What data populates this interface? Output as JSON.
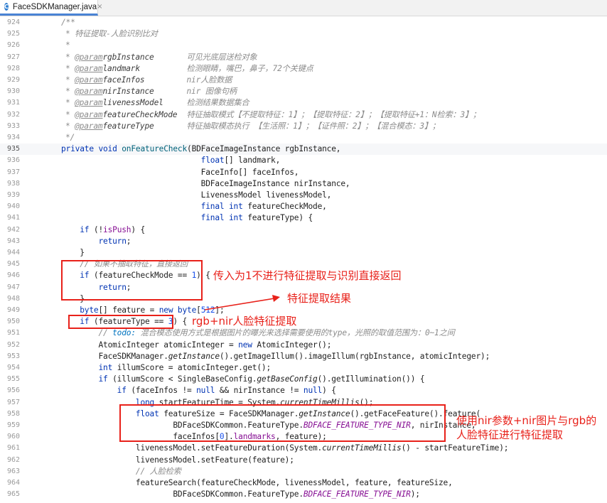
{
  "tab": {
    "icon": "C",
    "label": "FaceSDKManager.java",
    "close": "×"
  },
  "lines": [
    {
      "n": "924",
      "t": [
        [
          "",
          "/**",
          "cm"
        ]
      ]
    },
    {
      "n": "925",
      "t": [
        [
          "",
          "* 特征提取-人脸识别比对",
          "cm"
        ]
      ]
    },
    {
      "n": "926",
      "t": [
        [
          "",
          "*",
          "cm"
        ]
      ]
    },
    {
      "n": "927",
      "t": [
        [
          "",
          "* ",
          "cm"
        ],
        [
          "",
          "@param",
          "tag"
        ],
        [
          "",
          "rgbInstance       ",
          "pn"
        ],
        [
          "",
          "可见光底层送检对象",
          "cm"
        ]
      ]
    },
    {
      "n": "928",
      "t": [
        [
          "",
          "* ",
          "cm"
        ],
        [
          "",
          "@param",
          "tag"
        ],
        [
          "",
          "landmark          ",
          "pn"
        ],
        [
          "",
          "检测眼睛，嘴巴，鼻子，72个关键点",
          "cm"
        ]
      ]
    },
    {
      "n": "929",
      "t": [
        [
          "",
          "* ",
          "cm"
        ],
        [
          "",
          "@param",
          "tag"
        ],
        [
          "",
          "faceInfos         ",
          "pn"
        ],
        [
          "",
          "nir人脸数据",
          "cm"
        ]
      ]
    },
    {
      "n": "930",
      "t": [
        [
          "",
          "* ",
          "cm"
        ],
        [
          "",
          "@param",
          "tag"
        ],
        [
          "",
          "nirInstance       ",
          "pn"
        ],
        [
          "",
          "nir 图像句柄",
          "cm"
        ]
      ]
    },
    {
      "n": "931",
      "t": [
        [
          "",
          "* ",
          "cm"
        ],
        [
          "",
          "@param",
          "tag"
        ],
        [
          "",
          "livenessModel     ",
          "pn"
        ],
        [
          "",
          "检测结果数据集合",
          "cm"
        ]
      ]
    },
    {
      "n": "932",
      "t": [
        [
          "",
          "* ",
          "cm"
        ],
        [
          "",
          "@param",
          "tag"
        ],
        [
          "",
          "featureCheckMode  ",
          "pn"
        ],
        [
          "",
          "特征抽取模式【不提取特征：1】；【提取特征：2】；【提取特征+1：N检索：3】；",
          "cm"
        ]
      ]
    },
    {
      "n": "933",
      "t": [
        [
          "",
          "* ",
          "cm"
        ],
        [
          "",
          "@param",
          "tag"
        ],
        [
          "",
          "featureType       ",
          "pn"
        ],
        [
          "",
          "特征抽取模态执行 【生活照：1】；【证件照：2】；【混合模态：3】；",
          "cm"
        ]
      ]
    },
    {
      "n": "934",
      "t": [
        [
          "",
          "*/",
          "cm"
        ]
      ]
    },
    {
      "n": "935",
      "hl": true,
      "t": [
        [
          "",
          "private void ",
          "k"
        ],
        [
          "",
          "onFeatureCheck",
          ""
        ],
        [
          "",
          "(BDFaceImageInstance rgbInstance,",
          ""
        ]
      ]
    },
    {
      "n": "936",
      "t": [
        [
          "                              ",
          "float",
          "k"
        ],
        [
          "",
          "[] landmark,",
          ""
        ]
      ]
    },
    {
      "n": "937",
      "t": [
        [
          "                              ",
          "FaceInfo[] faceInfos,",
          ""
        ]
      ]
    },
    {
      "n": "938",
      "t": [
        [
          "                              ",
          "BDFaceImageInstance nirInstance,",
          ""
        ]
      ]
    },
    {
      "n": "939",
      "t": [
        [
          "                              ",
          "LivenessModel livenessModel,",
          ""
        ]
      ]
    },
    {
      "n": "940",
      "t": [
        [
          "                              ",
          "final int ",
          "k"
        ],
        [
          "",
          "featureCheckMode,",
          ""
        ]
      ]
    },
    {
      "n": "941",
      "t": [
        [
          "                              ",
          "final int ",
          "k"
        ],
        [
          "",
          "featureType) {",
          ""
        ]
      ]
    },
    {
      "n": "942",
      "t": [
        [
          "    ",
          "if ",
          "k"
        ],
        [
          "",
          "(!",
          ""
        ],
        [
          "",
          "isPush",
          "fld"
        ],
        [
          "",
          ") {",
          ""
        ]
      ]
    },
    {
      "n": "943",
      "t": [
        [
          "        ",
          "return",
          "k"
        ],
        [
          "",
          ";",
          ""
        ]
      ]
    },
    {
      "n": "944",
      "t": [
        [
          "    ",
          "}",
          ""
        ]
      ]
    },
    {
      "n": "945",
      "t": [
        [
          "    ",
          "// 如果不抽取特征，直接返回",
          "cm"
        ]
      ]
    },
    {
      "n": "946",
      "t": [
        [
          "    ",
          "if ",
          "k"
        ],
        [
          "",
          "(featureCheckMode == ",
          ""
        ],
        [
          "",
          "1",
          "num"
        ],
        [
          "",
          ") {",
          ""
        ]
      ]
    },
    {
      "n": "947",
      "t": [
        [
          "        ",
          "return",
          "k"
        ],
        [
          "",
          ";",
          ""
        ]
      ]
    },
    {
      "n": "948",
      "t": [
        [
          "    ",
          "}",
          ""
        ]
      ]
    },
    {
      "n": "949",
      "t": [
        [
          "    ",
          "byte",
          "k"
        ],
        [
          "",
          "[] feature = ",
          ""
        ],
        [
          "",
          "new byte",
          "k"
        ],
        [
          "",
          "[",
          ""
        ],
        [
          "",
          "512",
          "num"
        ],
        [
          "",
          "];",
          ""
        ]
      ]
    },
    {
      "n": "950",
      "t": [
        [
          "    ",
          "if ",
          "k"
        ],
        [
          "",
          "(featureType == ",
          ""
        ],
        [
          "",
          "3",
          "num"
        ],
        [
          "",
          ") {",
          ""
        ]
      ]
    },
    {
      "n": "951",
      "t": [
        [
          "        ",
          "// ",
          "cm"
        ],
        [
          "",
          "todo: ",
          "todo"
        ],
        [
          "",
          "混合模态使用方式是根据图片的曝光来选择需要使用的type，光照的取值范围为：0~1之间",
          "cm"
        ]
      ]
    },
    {
      "n": "952",
      "t": [
        [
          "        ",
          "AtomicInteger atomicInteger = ",
          ""
        ],
        [
          "",
          "new ",
          "k"
        ],
        [
          "",
          "AtomicInteger();",
          ""
        ]
      ]
    },
    {
      "n": "953",
      "t": [
        [
          "        ",
          "FaceSDKManager.",
          ""
        ],
        [
          "",
          "getInstance",
          "st"
        ],
        [
          "",
          "().getImageIllum().imageIllum(rgbInstance, atomicInteger);",
          ""
        ]
      ]
    },
    {
      "n": "954",
      "t": [
        [
          "        ",
          "int ",
          "k"
        ],
        [
          "",
          "illumScore = atomicInteger.get();",
          ""
        ]
      ]
    },
    {
      "n": "955",
      "t": [
        [
          "        ",
          "if ",
          "k"
        ],
        [
          "",
          "(illumScore < SingleBaseConfig.",
          ""
        ],
        [
          "",
          "getBaseConfig",
          "st"
        ],
        [
          "",
          "().getIllumination()) {",
          ""
        ]
      ]
    },
    {
      "n": "956",
      "t": [
        [
          "            ",
          "if ",
          "k"
        ],
        [
          "",
          "(faceInfos != ",
          ""
        ],
        [
          "",
          "null ",
          "k"
        ],
        [
          "",
          "&& nirInstance != ",
          ""
        ],
        [
          "",
          "null",
          "k"
        ],
        [
          "",
          ") {",
          ""
        ]
      ]
    },
    {
      "n": "957",
      "t": [
        [
          "                ",
          "long ",
          "k"
        ],
        [
          "",
          "startFeatureTime = System.",
          ""
        ],
        [
          "",
          "currentTimeMillis",
          "st"
        ],
        [
          "",
          "();",
          ""
        ]
      ]
    },
    {
      "n": "958",
      "t": [
        [
          "                ",
          "float ",
          "k"
        ],
        [
          "",
          "featureSize = FaceSDKManager.",
          ""
        ],
        [
          "",
          "getInstance",
          "st"
        ],
        [
          "",
          "().getFaceFeature().feature(",
          ""
        ]
      ]
    },
    {
      "n": "959",
      "t": [
        [
          "                        ",
          "BDFaceSDKCommon.FeatureType.",
          ""
        ],
        [
          "",
          "BDFACE_FEATURE_TYPE_NIR",
          "cst"
        ],
        [
          "",
          ", nirInstance,",
          ""
        ]
      ]
    },
    {
      "n": "960",
      "t": [
        [
          "                        ",
          "faceInfos[",
          ""
        ],
        [
          "",
          "0",
          "num"
        ],
        [
          "",
          "].",
          ""
        ],
        [
          "",
          "landmarks",
          "fld"
        ],
        [
          "",
          ", feature);",
          ""
        ]
      ]
    },
    {
      "n": "961",
      "t": [
        [
          "                ",
          "livenessModel.setFeatureDuration(System.",
          ""
        ],
        [
          "",
          "currentTimeMillis",
          "st"
        ],
        [
          "",
          "() - startFeatureTime);",
          ""
        ]
      ]
    },
    {
      "n": "962",
      "t": [
        [
          "                ",
          "livenessModel.setFeature(feature);",
          ""
        ]
      ]
    },
    {
      "n": "963",
      "t": [
        [
          "                ",
          "// 人脸检索",
          "cm"
        ]
      ]
    },
    {
      "n": "964",
      "t": [
        [
          "                ",
          "featureSearch(featureCheckMode, livenessModel, feature, featureSize,",
          ""
        ]
      ]
    },
    {
      "n": "965",
      "t": [
        [
          "                        ",
          "BDFaceSDKCommon.FeatureType.",
          ""
        ],
        [
          "",
          "BDFACE_FEATURE_TYPE_NIR",
          "cst"
        ],
        [
          "",
          ");",
          ""
        ]
      ]
    }
  ],
  "annotations": {
    "a1": "传入为1不进行特征提取与识别直接返回",
    "a2": "特征提取结果",
    "a3": "rgb+nir人脸特征提取",
    "a4_line1": "使用nir参数+nir图片与rgb的",
    "a4_line2": "人脸特征进行特征提取"
  },
  "colors": {
    "annotation": "#e8211a",
    "keyword": "#0033b3",
    "comment": "#8c8c8c"
  }
}
